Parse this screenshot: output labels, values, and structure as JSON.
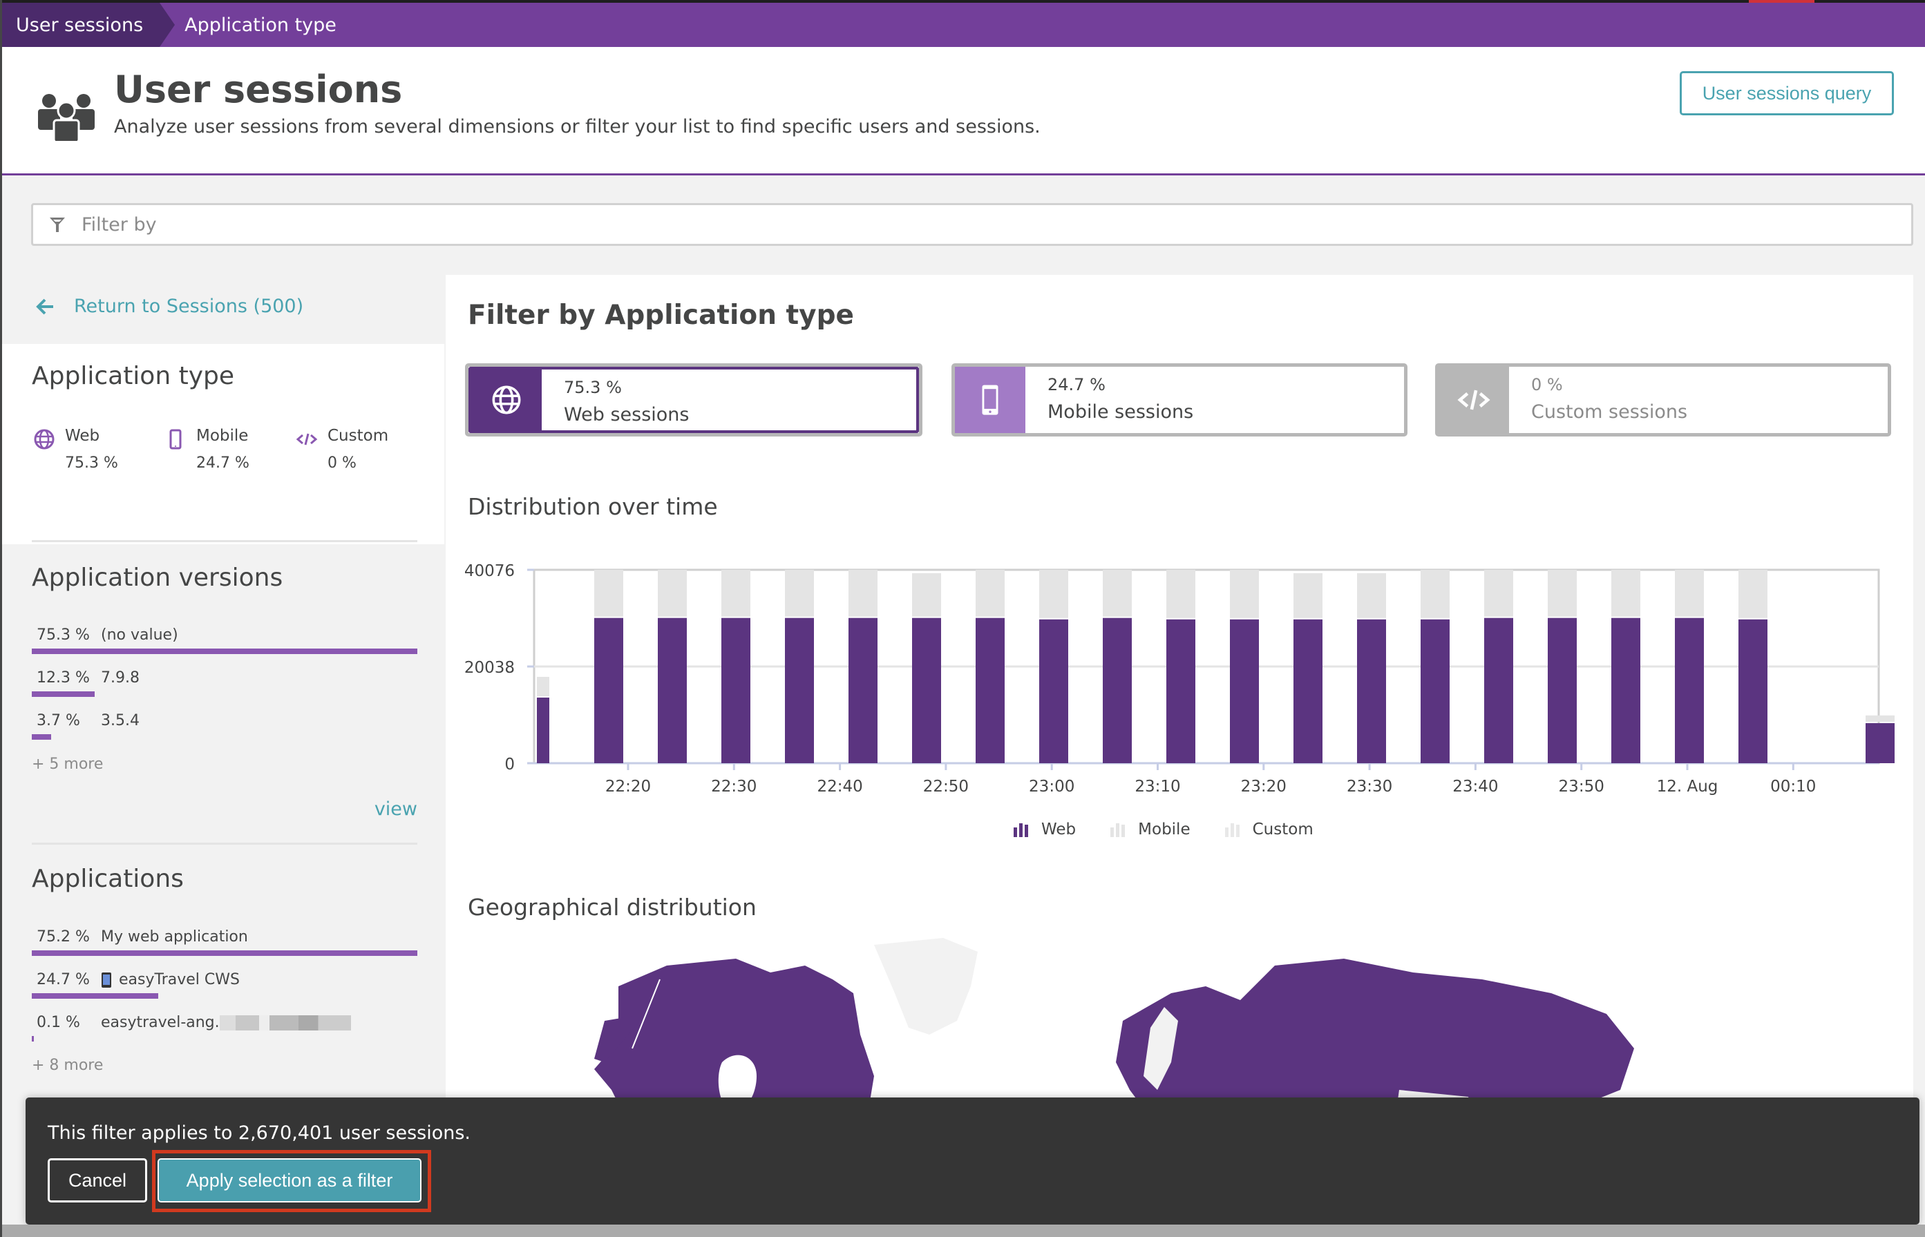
{
  "breadcrumb": {
    "items": [
      {
        "label": "User sessions"
      },
      {
        "label": "Application type"
      }
    ]
  },
  "header": {
    "icon": "users-icon",
    "title": "User sessions",
    "subtitle": "Analyze user sessions from several dimensions or filter your list to find specific users and sessions.",
    "query_button": "User sessions query"
  },
  "filter": {
    "placeholder": "Filter by",
    "value": ""
  },
  "sidebar": {
    "return_link": "Return to Sessions (500)",
    "application_type": {
      "title": "Application type",
      "items": [
        {
          "icon": "globe-icon",
          "name": "Web",
          "percent": "75.3 %"
        },
        {
          "icon": "mobile-icon",
          "name": "Mobile",
          "percent": "24.7 %"
        },
        {
          "icon": "code-icon",
          "name": "Custom",
          "percent": "0 %"
        }
      ]
    },
    "application_versions": {
      "title": "Application versions",
      "items": [
        {
          "percent": "75.3 %",
          "label": "(no value)",
          "fraction": 1.0
        },
        {
          "percent": "12.3 %",
          "label": "7.9.8",
          "fraction": 0.163
        },
        {
          "percent": "3.7 %",
          "label": "3.5.4",
          "fraction": 0.05
        }
      ],
      "more": "+ 5 more",
      "view_link": "view"
    },
    "applications": {
      "title": "Applications",
      "items": [
        {
          "percent": "75.2 %",
          "label": "My web application",
          "fraction": 1.0,
          "icon": ""
        },
        {
          "percent": "24.7 %",
          "label": "easyTravel CWS",
          "fraction": 0.328,
          "icon": "mobile-app-icon"
        },
        {
          "percent": "0.1 %",
          "label": "easytravel-ang.",
          "fraction": 0.002,
          "icon": "",
          "redacted": true
        }
      ],
      "more": "+ 8 more"
    }
  },
  "main": {
    "title": "Filter by Application type",
    "type_cards": [
      {
        "id": "web",
        "icon": "globe-icon",
        "percent": "75.3 %",
        "label": "Web sessions",
        "selected": true
      },
      {
        "id": "mobile",
        "icon": "mobile-icon",
        "percent": "24.7 %",
        "label": "Mobile sessions",
        "selected": false
      },
      {
        "id": "custom",
        "icon": "code-icon",
        "percent": "0 %",
        "label": "Custom sessions",
        "selected": false
      }
    ],
    "distribution_title": "Distribution over time",
    "geo_title": "Geographical distribution"
  },
  "colors": {
    "web": "#5b3480",
    "mobile": "#e4e4e4",
    "custom": "#e8e8e8",
    "accent": "#4aa3b0",
    "brand": "#733f9a"
  },
  "chart_data": {
    "type": "bar",
    "stacked": true,
    "title": "Distribution over time",
    "xlabel": "",
    "ylabel": "",
    "ylim": [
      0,
      40076
    ],
    "yticks": [
      0,
      20038,
      40076
    ],
    "xtick_labels": [
      "22:20",
      "22:30",
      "22:40",
      "22:50",
      "23:00",
      "23:10",
      "23:20",
      "23:30",
      "23:40",
      "23:50",
      "12. Aug",
      "00:10"
    ],
    "legend": [
      "Web",
      "Mobile",
      "Custom"
    ],
    "legend_position": "bottom",
    "grid": true,
    "categories": [
      "22:13",
      "22:17",
      "22:23",
      "22:27",
      "22:33",
      "22:37",
      "22:43",
      "22:47",
      "22:53",
      "22:57",
      "23:03",
      "23:07",
      "23:13",
      "23:17",
      "23:23",
      "23:27",
      "23:33",
      "23:37",
      "23:43",
      "23:47",
      "00:13"
    ],
    "series": [
      {
        "name": "Web",
        "values": [
          13600,
          30100,
          30100,
          30100,
          30100,
          30100,
          30100,
          30100,
          29800,
          30100,
          29800,
          29800,
          29800,
          29800,
          29800,
          30100,
          30100,
          30100,
          30100,
          29800,
          8300
        ]
      },
      {
        "name": "Mobile",
        "values": [
          4300,
          9976,
          9976,
          9976,
          9976,
          9976,
          9276,
          9976,
          10276,
          9976,
          10276,
          10276,
          9576,
          9576,
          10276,
          9976,
          9976,
          9976,
          9976,
          10276,
          1600
        ]
      },
      {
        "name": "Custom",
        "values": [
          0,
          0,
          0,
          0,
          0,
          0,
          0,
          0,
          0,
          0,
          0,
          0,
          0,
          0,
          0,
          0,
          0,
          0,
          0,
          0,
          0
        ]
      }
    ]
  },
  "toast": {
    "message": "This filter applies to 2,670,401 user sessions.",
    "cancel": "Cancel",
    "apply": "Apply selection as a filter"
  }
}
